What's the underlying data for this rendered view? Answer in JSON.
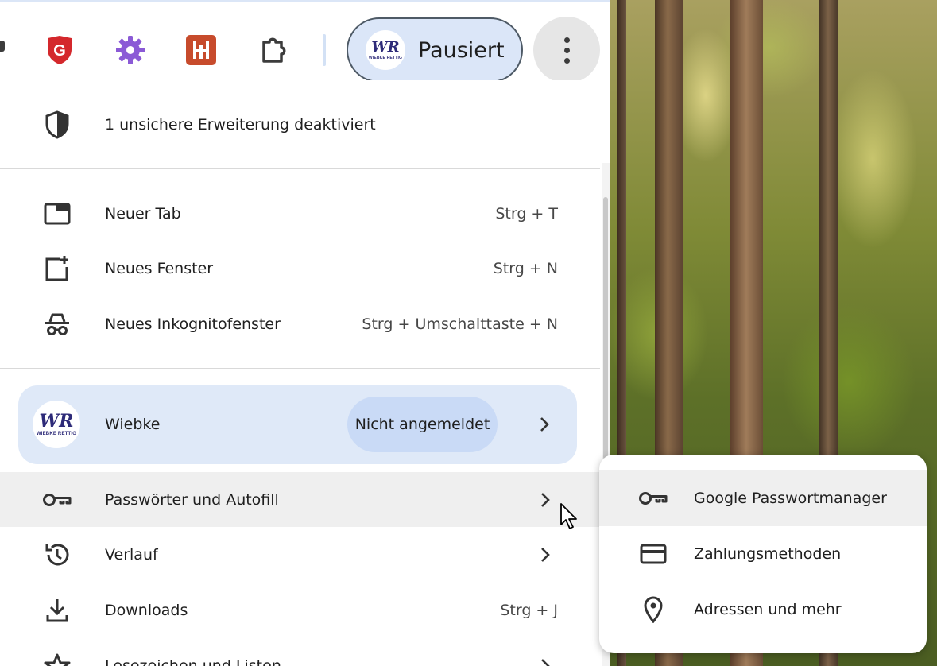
{
  "toolbar": {
    "extensions": [
      {
        "name": "gdata-shield",
        "color": "#d4282c"
      },
      {
        "name": "gear",
        "color": "#8b5ad6"
      },
      {
        "name": "hubspot-like",
        "color": "#c0392b"
      },
      {
        "name": "extensions-puzzle",
        "color": "#3c3c3c"
      }
    ],
    "profile_chip": {
      "label": "Pausiert",
      "avatar_initials": "WR",
      "avatar_subtitle": "WIEBKE RETTIG"
    },
    "menu_button_icon": "kebab-vertical"
  },
  "menu": {
    "security_notice": {
      "icon": "shield-half",
      "label": "1 unsichere Erweiterung deaktiviert"
    },
    "items_top": [
      {
        "icon": "new-tab",
        "label": "Neuer Tab",
        "shortcut": "Strg + T"
      },
      {
        "icon": "new-window",
        "label": "Neues Fenster",
        "shortcut": "Strg + N"
      },
      {
        "icon": "incognito",
        "label": "Neues Inkognitofenster",
        "shortcut": "Strg + Umschalttaste + N"
      }
    ],
    "profile": {
      "name": "Wiebke",
      "status": "Nicht angemeldet",
      "avatar_initials": "WR",
      "avatar_subtitle": "WIEBKE RETTIG"
    },
    "items_bottom": [
      {
        "icon": "key",
        "label": "Passwörter und Autofill",
        "shortcut": "",
        "has_submenu": true,
        "hovered": true
      },
      {
        "icon": "history",
        "label": "Verlauf",
        "shortcut": "",
        "has_submenu": true
      },
      {
        "icon": "download",
        "label": "Downloads",
        "shortcut": "Strg + J",
        "has_submenu": false
      },
      {
        "icon": "star",
        "label": "Lesezeichen und Listen",
        "shortcut": "",
        "has_submenu": true
      }
    ]
  },
  "submenu": {
    "items": [
      {
        "icon": "key",
        "label": "Google Passwortmanager",
        "hovered": true
      },
      {
        "icon": "credit-card",
        "label": "Zahlungsmethoden"
      },
      {
        "icon": "location-pin",
        "label": "Adressen und mehr"
      }
    ]
  },
  "colors": {
    "accent_light": "#dbe6f8",
    "pill": "#c9daf6",
    "hover": "#efefef",
    "text": "#1f1f1f"
  }
}
